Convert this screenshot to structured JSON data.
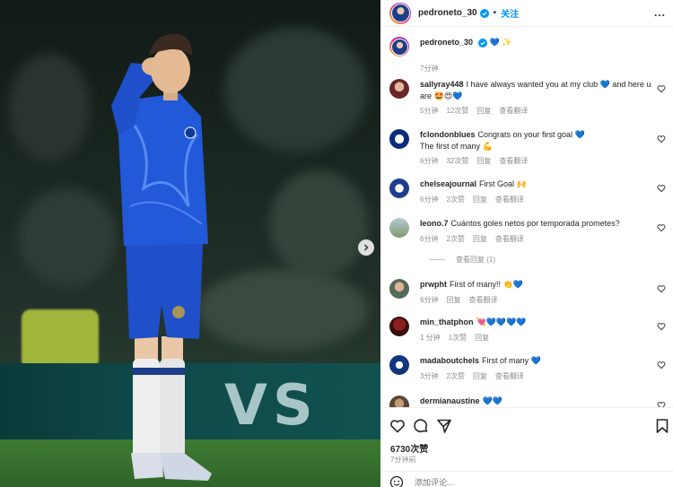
{
  "header": {
    "username": "pedroneto_30",
    "dot": "•",
    "follow_label": "关注",
    "more_label": "..."
  },
  "caption": {
    "username": "pedroneto_30",
    "emoji": "💙 ✨",
    "time": "7分钟"
  },
  "comments": [
    {
      "username": "sallyray448",
      "text": "I have always wanted you at my club 💙 and here u are 🤩😍💙",
      "time": "5分钟",
      "likes": "12次赞",
      "reply": "回复",
      "translate": "查看翻译"
    },
    {
      "username": "fclondonblues",
      "text": "Congrats on your first goal 💙",
      "text2": "The first of many 💪",
      "time": "6分钟",
      "likes": "32次赞",
      "reply": "回复",
      "translate": "查看翻译"
    },
    {
      "username": "chelseajournal",
      "text": "First Goal 🙌",
      "time": "6分钟",
      "likes": "2次赞",
      "reply": "回复",
      "translate": "查看翻译"
    },
    {
      "username": "leono.7",
      "text": "Cuántos goles netos por temporada prometes?",
      "time": "6分钟",
      "likes": "2次赞",
      "reply": "回复",
      "translate": "查看翻译",
      "view_replies": "查看回复 (1)"
    },
    {
      "username": "prwpht",
      "text": "First of many!! 👏💙",
      "time": "6分钟",
      "reply": "回复",
      "translate": "查看翻译"
    },
    {
      "username": "min_thatphon",
      "text": "💘💙💙💙💙",
      "time": "1 分钟",
      "likes": "1次赞",
      "reply": "回复"
    },
    {
      "username": "madaboutchels",
      "text": "First of many 💙",
      "time": "3分钟",
      "likes": "2次赞",
      "reply": "回复",
      "translate": "查看翻译"
    },
    {
      "username": "dermianaustine",
      "text": "💙💙"
    }
  ],
  "footer": {
    "likes": "6730次赞",
    "time": "7分钟前",
    "add_comment_placeholder": "添加评论..."
  },
  "colors": {
    "accent": "#0095f6",
    "muted": "#8e8e8e",
    "kit_blue": "#1f4fc9"
  },
  "icons": [
    "verified-icon",
    "heart-icon",
    "comment-icon",
    "share-icon",
    "bookmark-icon",
    "chevron-right-icon",
    "smile-icon"
  ]
}
